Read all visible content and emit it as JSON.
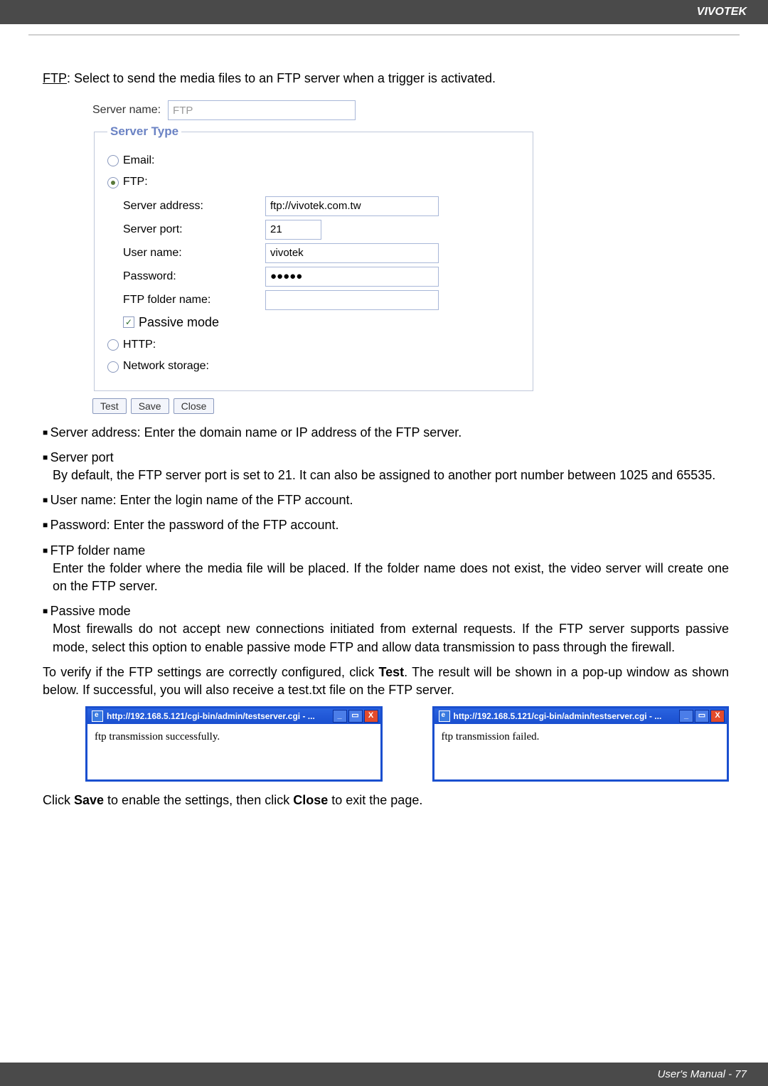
{
  "header": {
    "brand": "VIVOTEK"
  },
  "intro": {
    "ftp_tag": "FTP",
    "text": ": Select to send the media files to an FTP server when a trigger is activated."
  },
  "form": {
    "server_name_label": "Server name:",
    "server_name_value": "FTP",
    "fieldset_legend": "Server Type",
    "radios": {
      "email": "Email:",
      "ftp": "FTP:",
      "http": "HTTP:",
      "network_storage": "Network storage:"
    },
    "ftp_fields": {
      "server_address_lbl": "Server address:",
      "server_address_val": "ftp://vivotek.com.tw",
      "server_port_lbl": "Server port:",
      "server_port_val": "21",
      "user_name_lbl": "User name:",
      "user_name_val": "vivotek",
      "password_lbl": "Password:",
      "password_val": "●●●●●",
      "folder_lbl": "FTP folder name:",
      "folder_val": "",
      "passive_mode_lbl": "Passive mode"
    },
    "buttons": {
      "test": "Test",
      "save": "Save",
      "close": "Close"
    }
  },
  "doc": {
    "server_address": "Server address: Enter the domain name or IP address of the FTP server.",
    "server_port_title": "Server port",
    "server_port_body": "By default, the FTP server port is set to 21. It can also be assigned to another port number between 1025 and 65535.",
    "user_name": "User name: Enter the login name of the FTP account.",
    "password": "Password: Enter the password of the FTP account.",
    "folder_title": "FTP folder name",
    "folder_body": "Enter the folder where the media file will be placed. If the folder name does not exist, the video server will create one on the FTP server.",
    "passive_title": "Passive mode",
    "passive_body": "Most firewalls do not accept new connections initiated from external requests. If the FTP server supports passive mode, select this option to enable passive mode FTP and allow data transmission to pass through the firewall.",
    "verify1": "To verify if the FTP settings are correctly configured, click ",
    "verify_test": "Test",
    "verify2": ". The result will be shown in a pop-up window as shown below. If successful, you will also receive a test.txt file on the FTP server.",
    "final1": "Click ",
    "final_save": "Save",
    "final2": " to enable the settings, then click ",
    "final_close": "Close",
    "final3": " to exit the page."
  },
  "popups": {
    "url": "http://192.168.5.121/cgi-bin/admin/testserver.cgi - ...",
    "success": "ftp transmission successfully.",
    "fail": "ftp transmission failed."
  },
  "footer": {
    "text": "User's Manual - 77"
  }
}
